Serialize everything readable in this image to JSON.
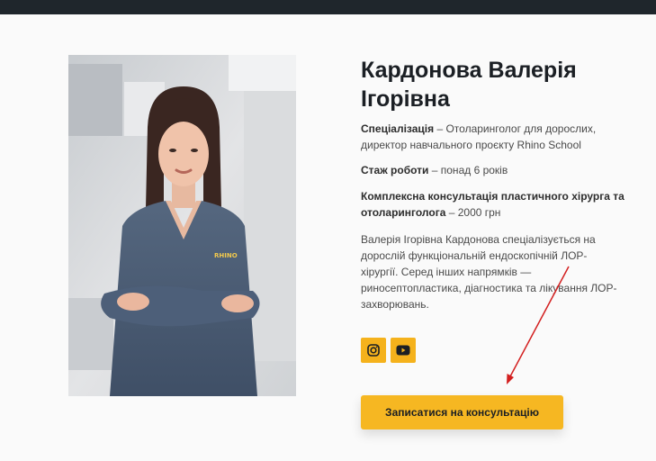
{
  "doctor": {
    "name_line1": "Кардонова Валерія",
    "name_line2": "Ігорівна",
    "specialization_label": "Спеціалізація",
    "specialization_line1": " – Отоларинголог для дорослих,",
    "specialization_line2": "директор навчального проєкту Rhino School",
    "experience_label": "Стаж роботи",
    "experience_value": " – понад 6 років",
    "consultation_label_line1": "Комплексна консультація пластичного хірурга та",
    "consultation_label_line2": "отоларинголога",
    "consultation_price": " – 2000 грн",
    "bio_lines": [
      "Валерія Ігорівна Кардонова спеціалізується на",
      "дорослій функціональній ендоскопічній ЛОР-",
      "хірургії. Серед інших напрямків —",
      "риносептопластика, діагностика та лікування ЛОР-",
      "захворювань."
    ]
  },
  "socials": [
    {
      "icon": "instagram-icon"
    },
    {
      "icon": "youtube-icon"
    }
  ],
  "cta_label": "Записатися на консультацію",
  "colors": {
    "accent": "#f6b722",
    "topbar": "#1f262c",
    "scrubs": "#4a5b77",
    "annotation_arrow": "#d31f1f"
  },
  "photo": {
    "logo_text": "RHINO"
  }
}
